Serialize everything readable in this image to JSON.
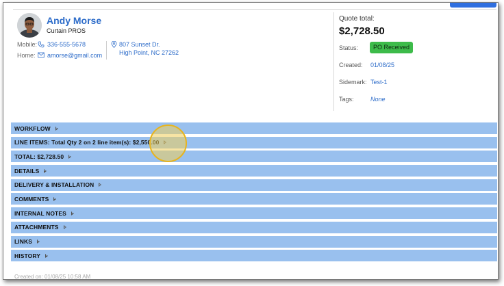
{
  "customer": {
    "name": "Andy Morse",
    "company": "Curtain PROS",
    "mobile_label": "Mobile:",
    "mobile": "336-555-5678",
    "home_label": "Home:",
    "email": "amorse@gmail.com",
    "address_line1": "807 Sunset Dr.",
    "address_line2": "High Point, NC 27262"
  },
  "summary": {
    "quote_total_label": "Quote total:",
    "quote_total": "$2,728.50",
    "status_label": "Status:",
    "status": "PO Received",
    "created_label": "Created:",
    "created": "01/08/25",
    "sidemark_label": "Sidemark:",
    "sidemark": "Test-1",
    "tags_label": "Tags:",
    "tags": "None"
  },
  "sections": [
    {
      "title": "WORKFLOW"
    },
    {
      "title": "LINE ITEMS: Total Qty 2 on 2 line item(s): $2,550.00"
    },
    {
      "title": "TOTAL: $2,728.50"
    },
    {
      "title": "DETAILS"
    },
    {
      "title": "DELIVERY & INSTALLATION"
    },
    {
      "title": "COMMENTS"
    },
    {
      "title": "INTERNAL NOTES"
    },
    {
      "title": "ATTACHMENTS"
    },
    {
      "title": "LINKS"
    },
    {
      "title": "HISTORY"
    }
  ],
  "footer": {
    "created_text": "Created on: 01/08/25 10:58 AM"
  },
  "colors": {
    "accent": "#2d6cc9",
    "section_bar": "#99c0ee",
    "status_badge": "#3dbb4a",
    "highlight": "#e8b41c"
  }
}
